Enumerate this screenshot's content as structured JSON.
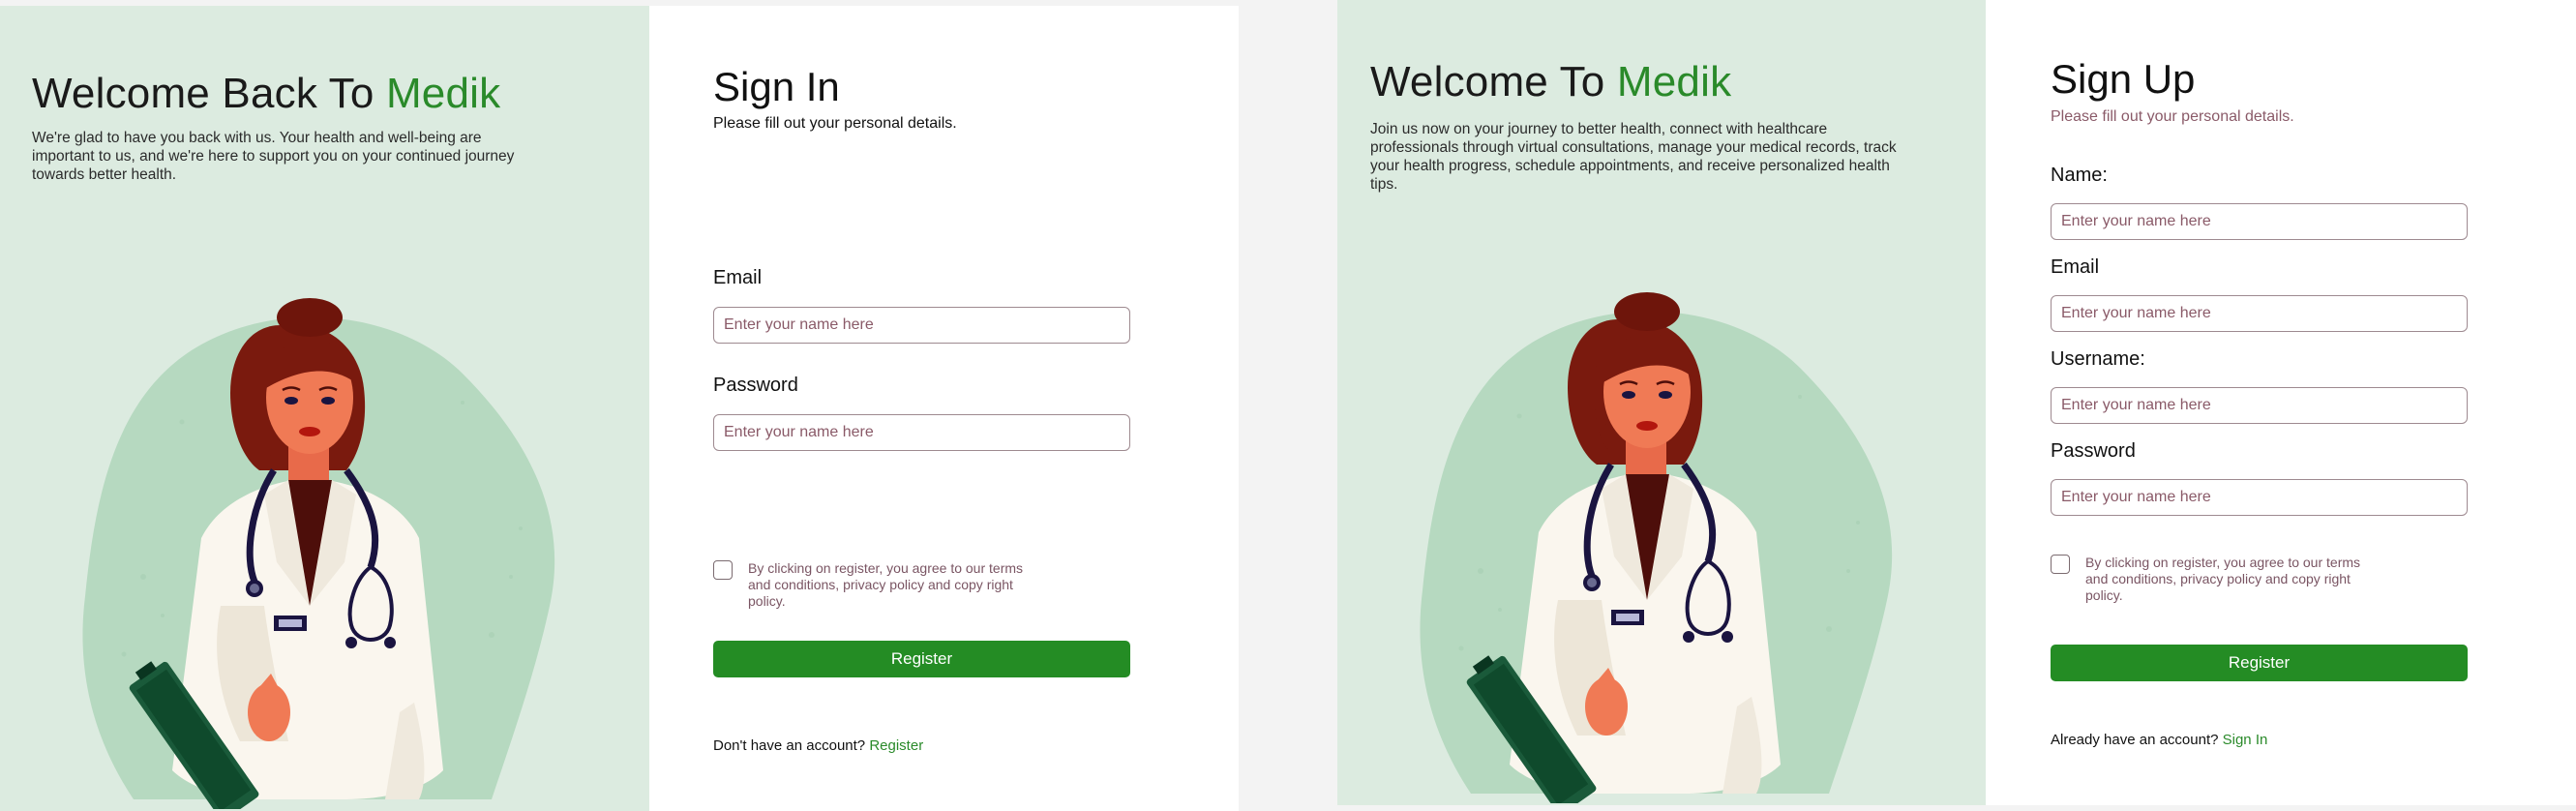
{
  "colors": {
    "hero_background": "#dcebe0",
    "brand_green": "#2a8a2a",
    "button_green": "#248c24",
    "placeholder_maroon": "#8a5a68"
  },
  "signin": {
    "hero": {
      "title_prefix": "Welcome Back To ",
      "brand": "Medik",
      "description": "We're glad to have you back with us. Your health and well-being are important to us, and we're here to support you on your continued journey towards better health."
    },
    "form": {
      "title": "Sign In",
      "subtitle": "Please fill out your personal details.",
      "fields": [
        {
          "label": "Email",
          "placeholder": "Enter your name here"
        },
        {
          "label": "Password",
          "placeholder": "Enter your name here"
        }
      ],
      "terms": "By clicking on register, you agree to our terms and conditions, privacy policy and copy right policy.",
      "button": "Register",
      "footer_text": "Don't  have an account?",
      "footer_link": "Register"
    }
  },
  "signup": {
    "hero": {
      "title_prefix": "Welcome To ",
      "brand": "Medik",
      "description": "Join us now on your journey to better health, connect with healthcare professionals through virtual consultations, manage your medical records, track your health progress, schedule appointments, and receive personalized health tips."
    },
    "form": {
      "title": "Sign Up",
      "subtitle": "Please fill out your personal details.",
      "fields": [
        {
          "label": "Name:",
          "placeholder": "Enter your name here"
        },
        {
          "label": "Email",
          "placeholder": "Enter your name here"
        },
        {
          "label": "Username:",
          "placeholder": "Enter your name here"
        },
        {
          "label": "Password",
          "placeholder": "Enter your name here"
        }
      ],
      "terms": "By clicking on register, you agree to our terms and conditions, privacy policy and copy right policy.",
      "button": "Register",
      "footer_text": "Already  have an account?",
      "footer_link": "Sign In"
    }
  }
}
